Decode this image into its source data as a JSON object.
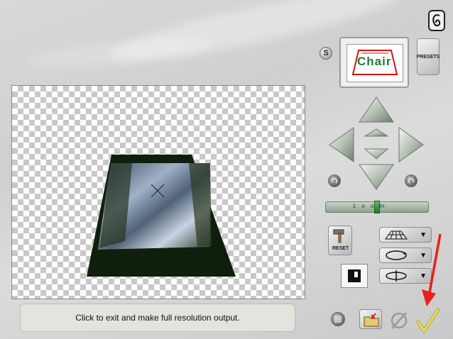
{
  "status": {
    "message": "Click to exit and make full resolution output."
  },
  "preset_panel": {
    "s_button": "S",
    "presets_label": "PRESETS",
    "thumbnail_text": "Chair"
  },
  "zoom_slider": {
    "label": "z o o m",
    "value": 0.5
  },
  "tools": {
    "reset_label": "RESET",
    "dropdowns": [
      "perspective-grid-icon",
      "rotate-icon",
      "spin-axis-icon"
    ]
  },
  "colors": {
    "accent_red": "#e8201a",
    "check_yellow": "#d8d24a"
  }
}
